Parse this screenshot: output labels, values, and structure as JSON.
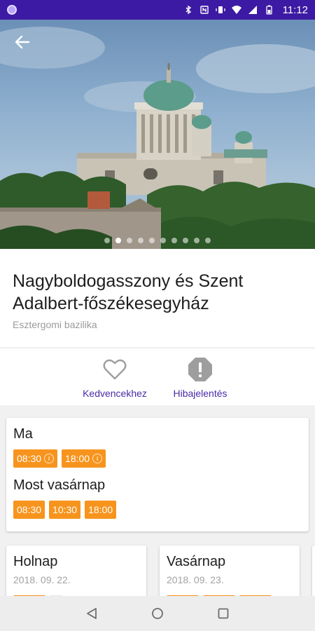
{
  "status_bar": {
    "time": "11:12",
    "icons": [
      "bluetooth-icon",
      "nfc-icon",
      "vibrate-icon",
      "wifi-icon",
      "signal-icon",
      "battery-icon"
    ]
  },
  "carousel": {
    "slide_count": 10,
    "active_index": 1
  },
  "place": {
    "title": "Nagyboldogasszony és Szent Adalbert-főszékesegyház",
    "subtitle": "Esztergomi  bazilika"
  },
  "actions": {
    "favorite_label": "Kedvencekhez",
    "report_label": "Hibajelentés"
  },
  "schedule": {
    "today": {
      "title": "Ma",
      "times": [
        "08:30",
        "18:00"
      ]
    },
    "sunday_now": {
      "title": "Most vasárnap",
      "times": [
        "08:30",
        "10:30",
        "18:00"
      ]
    },
    "tomorrow": {
      "title": "Holnap",
      "date": "2018. 09. 22."
    },
    "sunday": {
      "title": "Vasárnap",
      "date": "2018. 09. 23."
    }
  },
  "colors": {
    "status_bar": "#3d1aa3",
    "accent": "#4a2aa8",
    "chip": "#f7941d"
  }
}
